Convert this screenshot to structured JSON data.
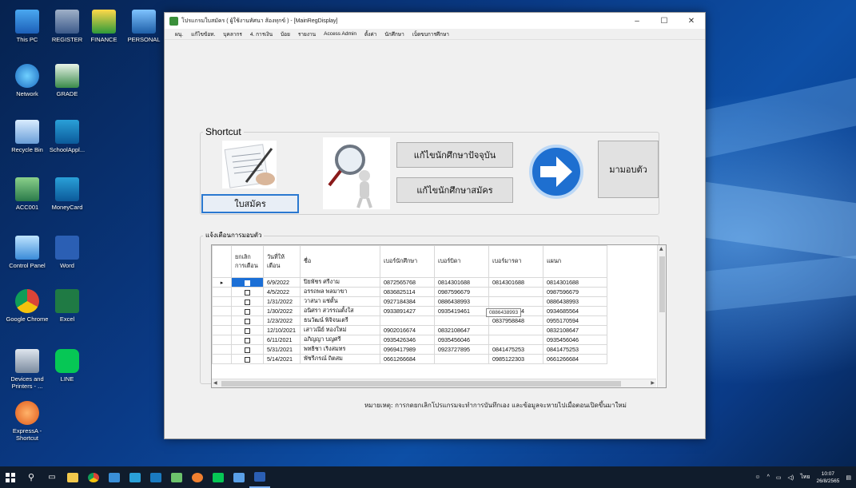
{
  "desktop": {
    "icons": [
      {
        "label": "This PC"
      },
      {
        "label": "REGISTER"
      },
      {
        "label": "FINANCE"
      },
      {
        "label": "PERSONAL"
      },
      {
        "label": "Network"
      },
      {
        "label": "GRADE"
      },
      {
        "label": "Recycle Bin"
      },
      {
        "label": "SchoolAppl..."
      },
      {
        "label": "ACC001"
      },
      {
        "label": "MoneyCard"
      },
      {
        "label": "Control Panel"
      },
      {
        "label": "Word"
      },
      {
        "label": "Google Chrome"
      },
      {
        "label": "Excel"
      },
      {
        "label": "Devices and Printers - ..."
      },
      {
        "label": "LINE"
      },
      {
        "label": "ExpressA - Shortcut"
      }
    ]
  },
  "window": {
    "title": "โปรแกรมใบสมัคร ( ผู้ใช้งานทัศนา ส้องทุกข์ ) - [MainRegDisplay]",
    "controls": {
      "minimize": "–",
      "maximize": "☐",
      "close": "✕"
    },
    "menu": [
      "ผนุ.",
      "แก้ไขข้อท.",
      "บุคลากร",
      "4. การเงิน",
      "บ้อย",
      "รายงาน",
      "Access Admin",
      "ตั้งค่า",
      "นักศึกษา",
      "เบ็ดขบการศึกษา"
    ]
  },
  "shortcut": {
    "label": "Shortcut",
    "btn_apply": "ใบสมัคร",
    "btn_edit_current": "แก้ไขนักศึกษาปัจจุบัน",
    "btn_edit_applicant": "แก้ไขนักศึกษาสมัคร",
    "btn_report": "มามอบตัว"
  },
  "notify": {
    "label": "แจ้งเตือนการมอบตัว",
    "columns": [
      "ยกเลิก การเตือน",
      "วันที่ให้ เตือน",
      "ชื่อ",
      "เบอร์นักศึกษา",
      "เบอร์บิดา",
      "เบอร์มารดา",
      "แผนก"
    ],
    "rows": [
      {
        "date": "6/9/2022",
        "name": "ปิยพัชร ศรีงาม",
        "student": "0872565768",
        "father": "0814301688",
        "mother": "0814301688",
        "dept": "0814301688"
      },
      {
        "date": "4/5/2022",
        "name": "อรรถพล พลมาขา",
        "student": "0836825114",
        "father": "0987596679",
        "mother": "",
        "dept": "0987596679"
      },
      {
        "date": "1/31/2022",
        "name": "วาสนา แช่ตั้น",
        "student": "0927184384",
        "father": "0886438993",
        "mother": "",
        "dept": "0886438993"
      },
      {
        "date": "1/30/2022",
        "name": "อนิศรา สวรรณตั้งใส",
        "student": "0933891427",
        "father": "0935419461",
        "mother": "0934685564",
        "dept": "0934685564"
      },
      {
        "date": "1/23/2022",
        "name": "ธนวัฒน์ พิจิจนเตรี",
        "student": "",
        "father": "",
        "mother": "0837958848",
        "dept": "0955170594"
      },
      {
        "date": "12/10/2021",
        "name": "เสาวณีย์ ทองใหม่",
        "student": "0902016674",
        "father": "0832108647",
        "mother": "",
        "dept": "0832108647"
      },
      {
        "date": "6/11/2021",
        "name": "อภิญญา บญศรี",
        "student": "0935426346",
        "father": "0935456046",
        "mother": "",
        "dept": "0935456046"
      },
      {
        "date": "5/31/2021",
        "name": "พทธิชา เริงสมทร",
        "student": "0969417989",
        "father": "0923727895",
        "mother": "0841475253",
        "dept": "0841475253"
      },
      {
        "date": "5/14/2021",
        "name": "พัชรีภรณ์ ถิตสม",
        "student": "0661266684",
        "father": "",
        "mother": "0985122303",
        "dept": "0661266684"
      }
    ],
    "tooltip": "0886438993"
  },
  "note": "หมายเหตุ: การกดยกเลิกโปรแกรมจะทำการบันทึกเอง และข้อมูลจะหายไปเมื่อตอนเปิดขึ้นมาใหม่",
  "taskbar": {
    "clock_time": "10:07",
    "clock_date": "26/8/2565",
    "lang": "ไทย"
  }
}
